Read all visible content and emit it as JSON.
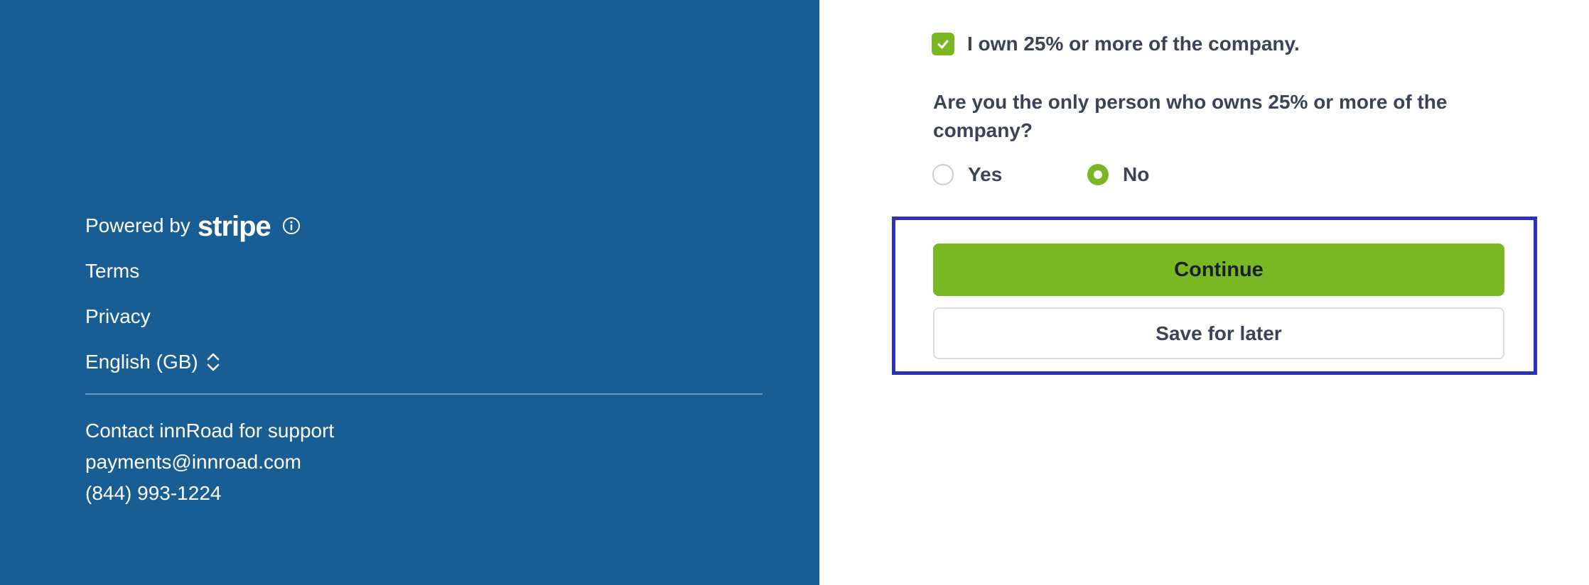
{
  "colors": {
    "left_panel_bg": "#185d94",
    "accent_green": "#7ab823",
    "highlight_border": "#2d2fbf",
    "text_dark": "#3c4257"
  },
  "sidebar": {
    "powered_by": "Powered by",
    "stripe_logo_text": "stripe",
    "info_icon": "info-circle-icon",
    "links": {
      "terms": "Terms",
      "privacy": "Privacy"
    },
    "language": {
      "label": "English (GB)",
      "icon": "chevrons-up-down-icon"
    },
    "contact": {
      "heading": "Contact innRoad for support",
      "email": "payments@innroad.com",
      "phone": "(844) 993-1224"
    }
  },
  "form": {
    "owner_checkbox": {
      "checked": true,
      "label": "I own 25% or more of the company."
    },
    "question": "Are you the only person who owns 25% or more of the company?",
    "radio_options": [
      {
        "label": "Yes",
        "selected": false
      },
      {
        "label": "No",
        "selected": true
      }
    ],
    "actions": {
      "continue_label": "Continue",
      "save_label": "Save for later"
    }
  }
}
